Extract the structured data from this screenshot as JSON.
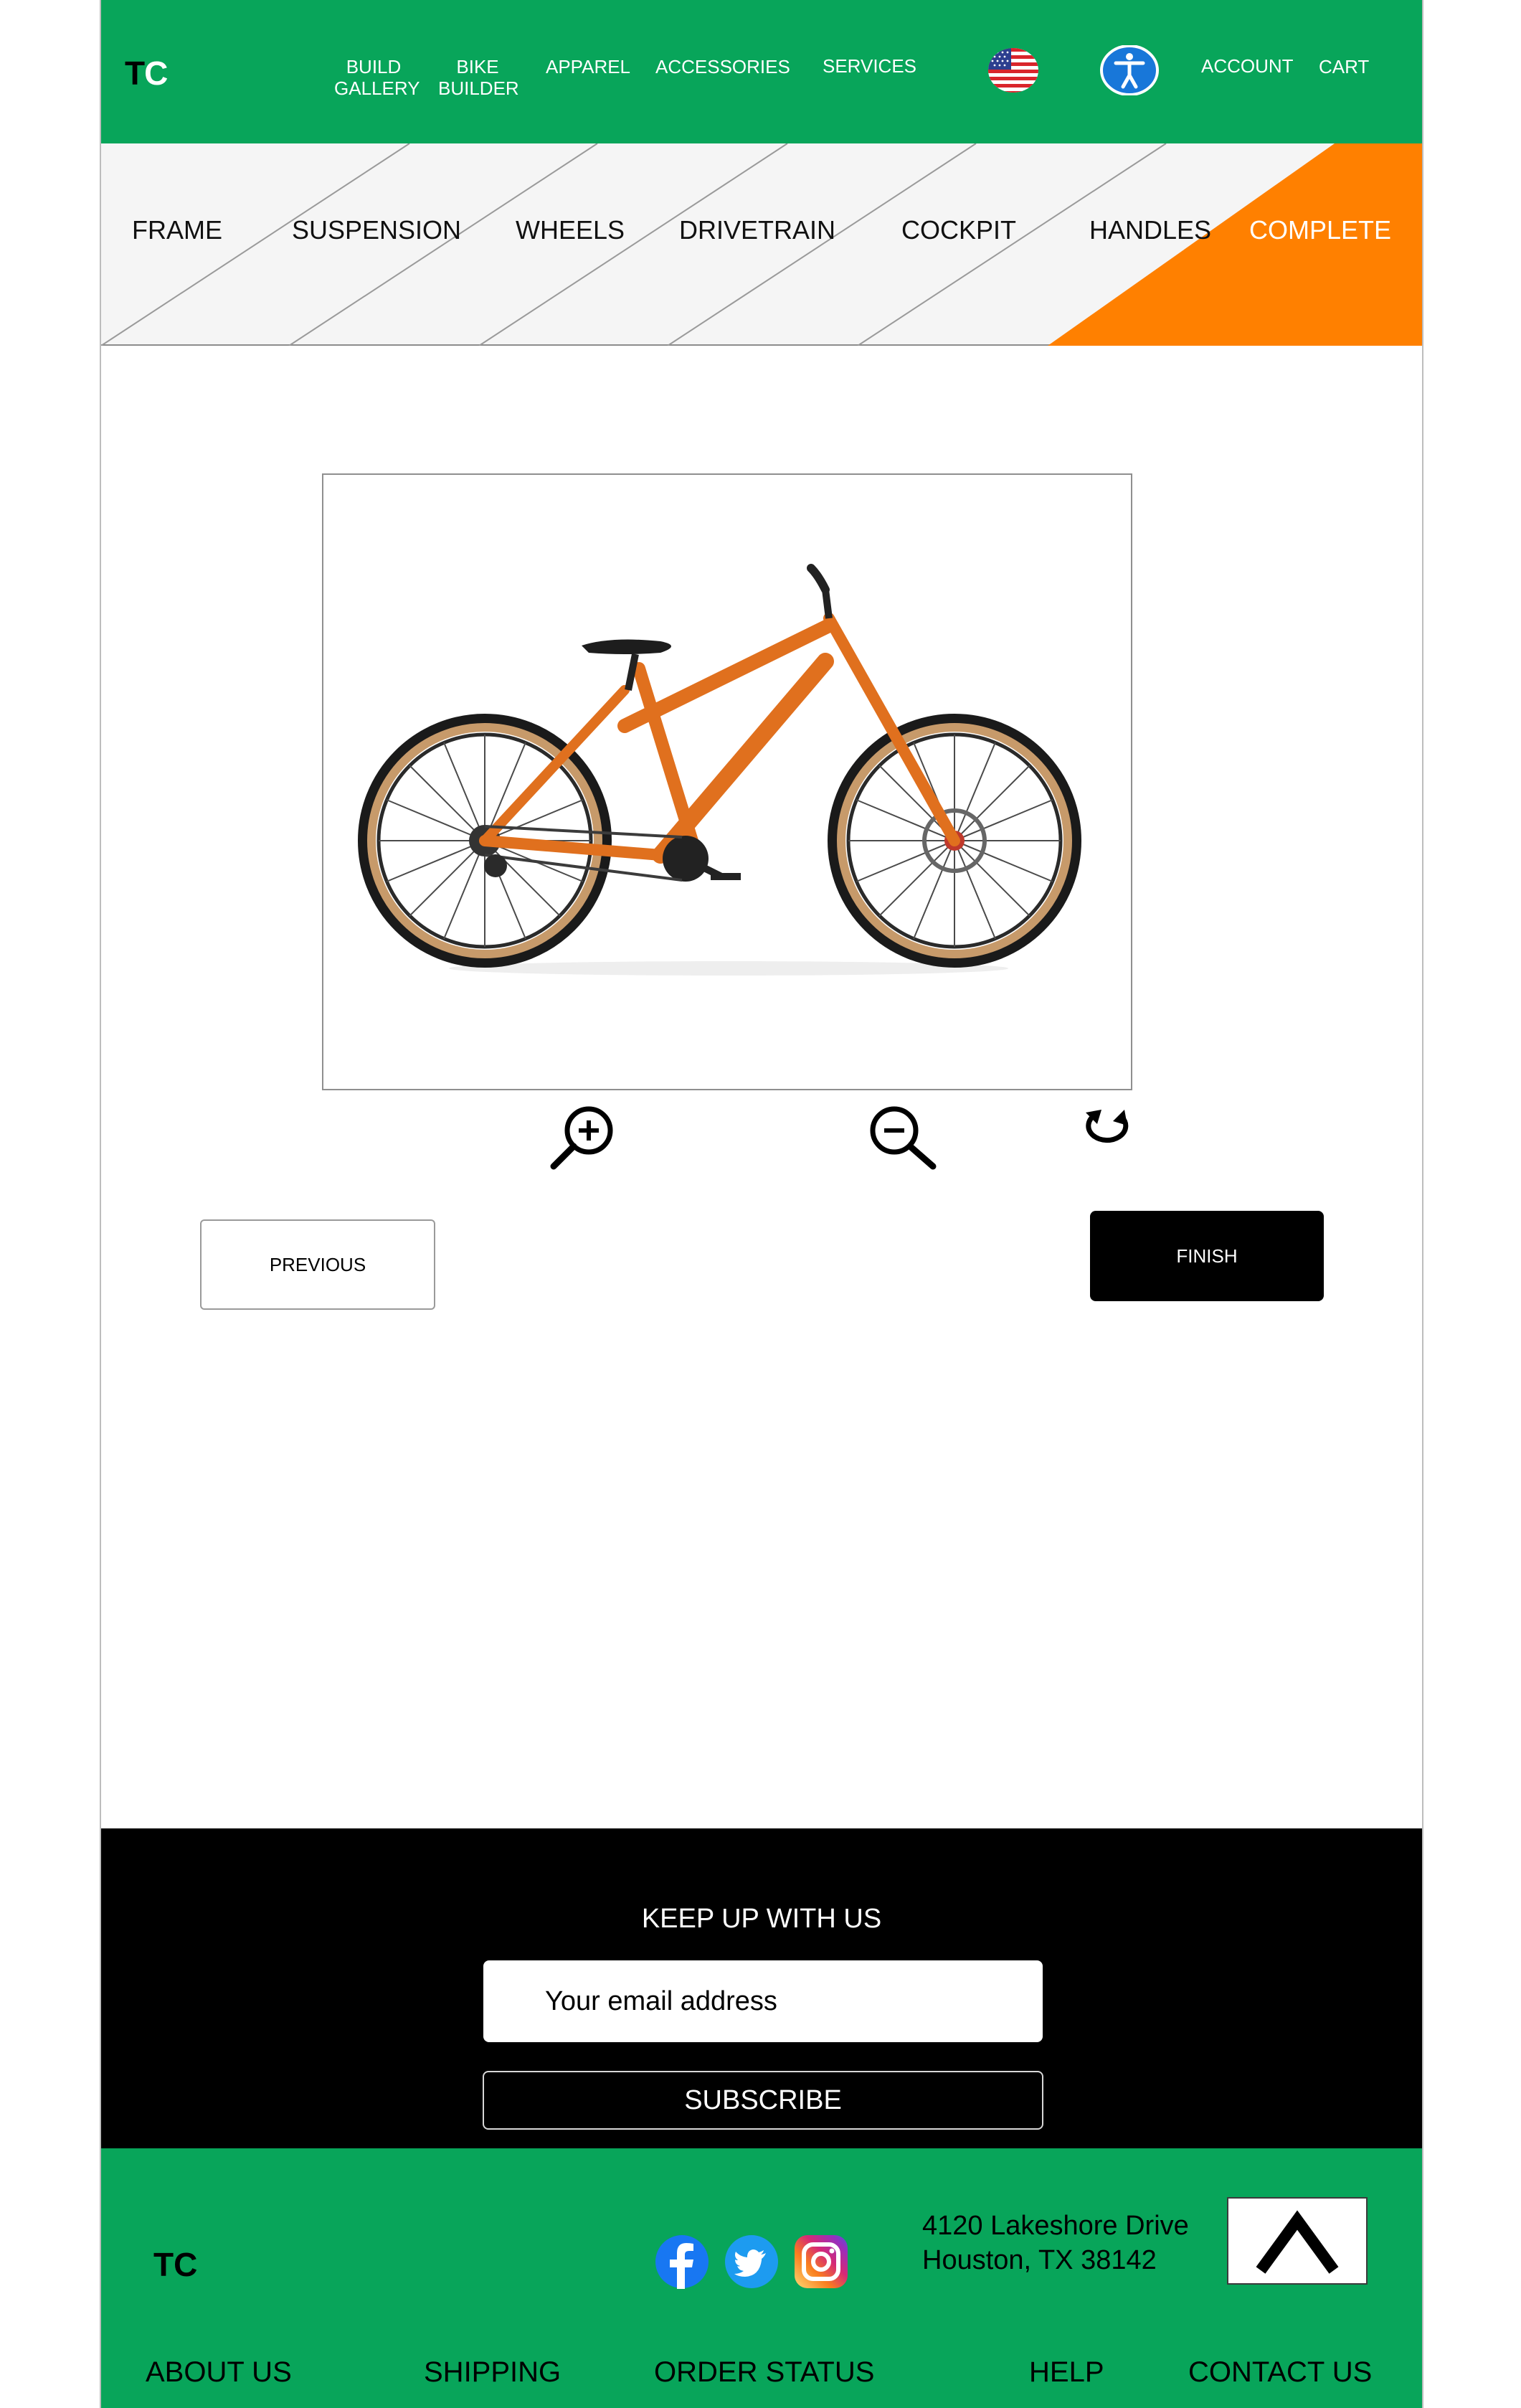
{
  "header": {
    "logo_t": "T",
    "logo_c": "C",
    "nav": {
      "build_gallery_1": "BUILD",
      "build_gallery_2": "GALLERY",
      "bike_builder_1": "BIKE",
      "bike_builder_2": "BUILDER",
      "apparel": "APPAREL",
      "accessories": "ACCESSORIES",
      "services": "SERVICES",
      "account": "ACCOUNT",
      "cart": "CART"
    },
    "flag_icon": "us-flag-icon",
    "accessibility_icon": "accessibility-icon"
  },
  "steps": {
    "items": [
      "FRAME",
      "SUSPENSION",
      "WHEELS",
      "DRIVETRAIN",
      "COCKPIT",
      "HANDLES",
      "COMPLETE"
    ],
    "active": "COMPLETE",
    "active_color": "#ff8000"
  },
  "viewer": {
    "image_icon": "orange-bike-image",
    "tools": [
      "zoom-in-icon",
      "zoom-out-icon",
      "rotate-icon"
    ]
  },
  "buttons": {
    "previous": "PREVIOUS",
    "finish": "FINISH"
  },
  "newsletter": {
    "title": "KEEP UP WITH US",
    "email_placeholder": "Your email address",
    "subscribe": "SUBSCRIBE"
  },
  "footer": {
    "logo_t": "T",
    "logo_c": "C",
    "address_line1": "4120 Lakeshore Drive",
    "address_line2": "Houston, TX 38142",
    "links": [
      "ABOUT US",
      "SHIPPING",
      "ORDER STATUS",
      "HELP",
      "CONTACT US"
    ],
    "social_icons": [
      "facebook-icon",
      "twitter-icon",
      "instagram-icon"
    ]
  },
  "colors": {
    "brand_green": "#08a55a",
    "accent_orange": "#ff8000",
    "black": "#000000"
  }
}
